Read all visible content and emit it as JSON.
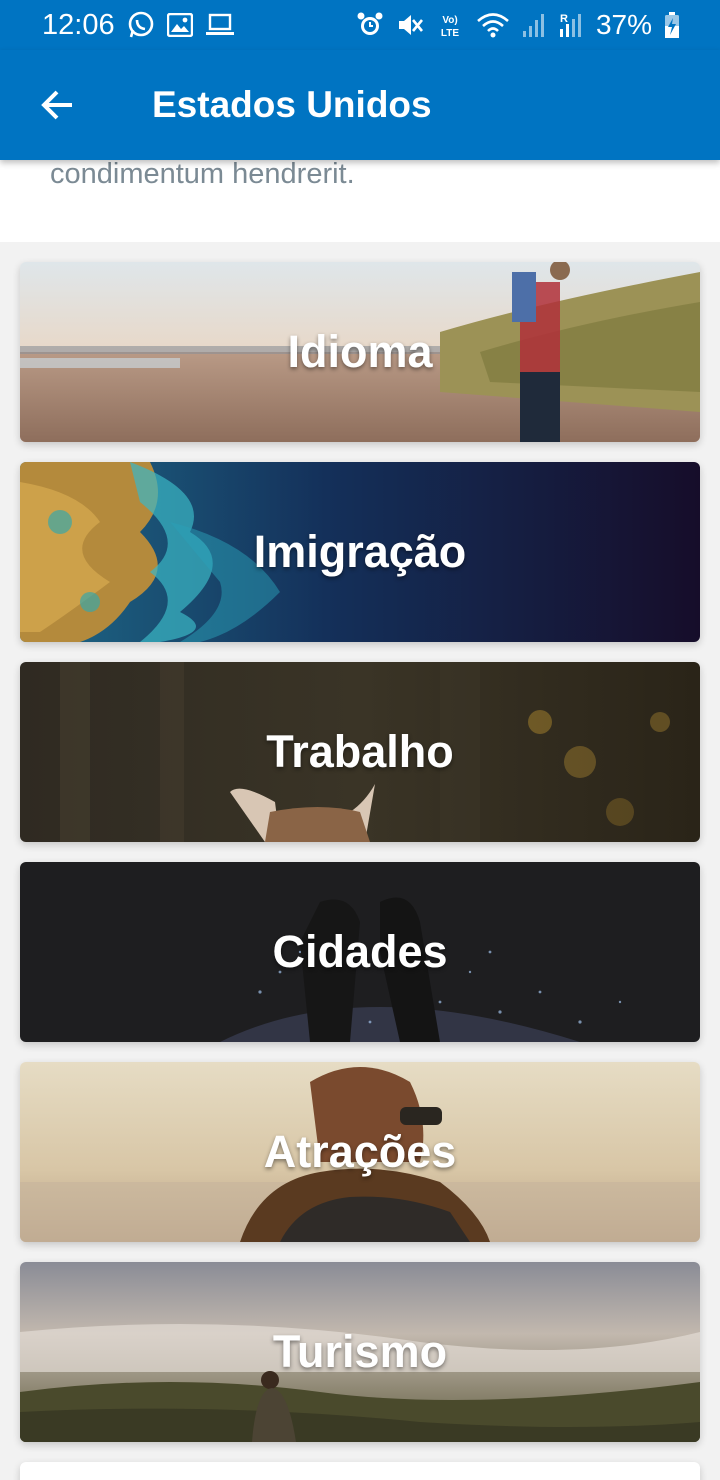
{
  "status_bar": {
    "time": "12:06",
    "battery": "37%",
    "icons_left": [
      "whatsapp-icon",
      "image-icon",
      "laptop-icon"
    ],
    "icons_right": [
      "alarm-icon",
      "mute-icon",
      "volte-icon",
      "wifi-icon",
      "signal-icon",
      "signal-roaming-icon",
      "battery-charging-icon"
    ]
  },
  "app_bar": {
    "title": "Estados Unidos",
    "back_icon": "arrow-left-icon",
    "color": "#0074c2"
  },
  "intro": {
    "text": "condimentum hendrerit."
  },
  "cards": [
    {
      "label": "Idioma"
    },
    {
      "label": "Imigração"
    },
    {
      "label": "Trabalho"
    },
    {
      "label": "Cidades"
    },
    {
      "label": "Atrações"
    },
    {
      "label": "Turismo"
    }
  ]
}
